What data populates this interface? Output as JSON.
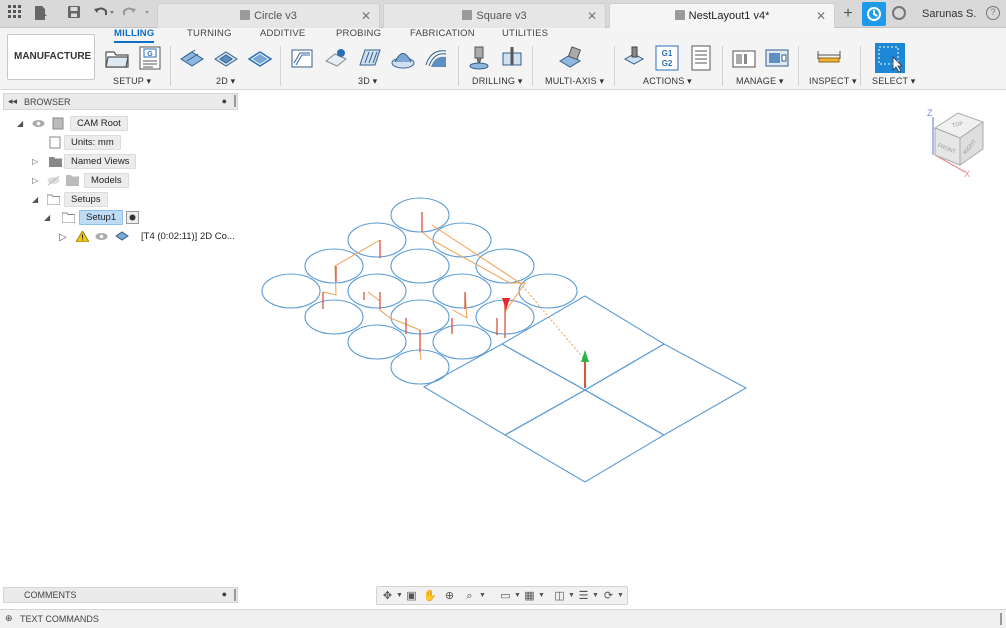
{
  "tabbar": {
    "tabs": [
      {
        "label": "Circle v3",
        "active": false
      },
      {
        "label": "Square v3",
        "active": false
      },
      {
        "label": "NestLayout1 v4*",
        "active": true
      }
    ],
    "user": "Sarunas S."
  },
  "ribbon": {
    "workspace": "MANUFACTURE",
    "tabs": [
      "MILLING",
      "TURNING",
      "ADDITIVE",
      "PROBING",
      "FABRICATION",
      "UTILITIES"
    ],
    "active_tab": "MILLING",
    "groups": [
      "SETUP",
      "2D",
      "3D",
      "DRILLING",
      "MULTI-AXIS",
      "ACTIONS",
      "MANAGE",
      "INSPECT",
      "SELECT"
    ],
    "gcode_icon_text": "G1\nG2",
    "accent_color": "#0b6fc4"
  },
  "browser": {
    "title": "BROWSER",
    "items": {
      "cam_root": "CAM Root",
      "units": "Units: mm",
      "named_views": "Named Views",
      "models": "Models",
      "setups": "Setups",
      "setup1": "Setup1",
      "operation": "[T4 (0:02:11)] 2D Co..."
    }
  },
  "bottom": {
    "comments": "COMMENTS",
    "text_commands": "TEXT COMMANDS"
  },
  "viewcube": {
    "top": "TOP",
    "front": "FRONT",
    "right": "RIGHT",
    "axis_z": "Z",
    "axis_x": "X"
  }
}
